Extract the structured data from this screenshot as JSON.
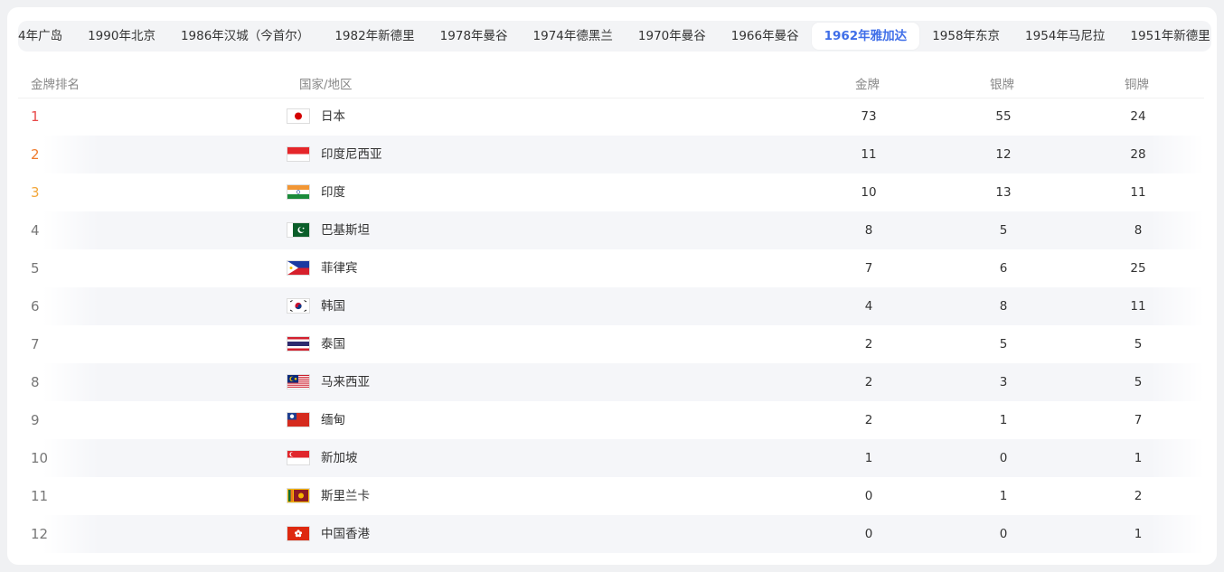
{
  "tabs": [
    {
      "label": "4年广岛"
    },
    {
      "label": "1990年北京"
    },
    {
      "label": "1986年汉城（今首尔）"
    },
    {
      "label": "1982年新德里"
    },
    {
      "label": "1978年曼谷"
    },
    {
      "label": "1974年德黑兰"
    },
    {
      "label": "1970年曼谷"
    },
    {
      "label": "1966年曼谷"
    },
    {
      "label": "1962年雅加达",
      "active": true
    },
    {
      "label": "1958年东京"
    },
    {
      "label": "1954年马尼拉"
    },
    {
      "label": "1951年新德里"
    }
  ],
  "table": {
    "headers": {
      "rank": "金牌排名",
      "country": "国家/地区",
      "gold": "金牌",
      "silver": "银牌",
      "bronze": "铜牌"
    },
    "rows": [
      {
        "rank": "1",
        "country": "日本",
        "gold": "73",
        "silver": "55",
        "bronze": "24",
        "flag": "japan-flag"
      },
      {
        "rank": "2",
        "country": "印度尼西亚",
        "gold": "11",
        "silver": "12",
        "bronze": "28",
        "flag": "indonesia-flag"
      },
      {
        "rank": "3",
        "country": "印度",
        "gold": "10",
        "silver": "13",
        "bronze": "11",
        "flag": "india-flag"
      },
      {
        "rank": "4",
        "country": "巴基斯坦",
        "gold": "8",
        "silver": "5",
        "bronze": "8",
        "flag": "pakistan-flag"
      },
      {
        "rank": "5",
        "country": "菲律宾",
        "gold": "7",
        "silver": "6",
        "bronze": "25",
        "flag": "philippines-flag"
      },
      {
        "rank": "6",
        "country": "韩国",
        "gold": "4",
        "silver": "8",
        "bronze": "11",
        "flag": "korea-flag"
      },
      {
        "rank": "7",
        "country": "泰国",
        "gold": "2",
        "silver": "5",
        "bronze": "5",
        "flag": "thailand-flag"
      },
      {
        "rank": "8",
        "country": "马来西亚",
        "gold": "2",
        "silver": "3",
        "bronze": "5",
        "flag": "malaysia-flag"
      },
      {
        "rank": "9",
        "country": "缅甸",
        "gold": "2",
        "silver": "1",
        "bronze": "7",
        "flag": "myanmar-flag"
      },
      {
        "rank": "10",
        "country": "新加坡",
        "gold": "1",
        "silver": "0",
        "bronze": "1",
        "flag": "singapore-flag"
      },
      {
        "rank": "11",
        "country": "斯里兰卡",
        "gold": "0",
        "silver": "1",
        "bronze": "2",
        "flag": "sri-lanka-flag"
      },
      {
        "rank": "12",
        "country": "中国香港",
        "gold": "0",
        "silver": "0",
        "bronze": "1",
        "flag": "hong-kong-flag"
      }
    ]
  },
  "colors": {
    "accent": "#3f6ee8",
    "rank1": "#e84a4a",
    "rank2": "#ef7b2d",
    "rank3": "#f2a63a",
    "stripe": "#f5f6f9"
  }
}
